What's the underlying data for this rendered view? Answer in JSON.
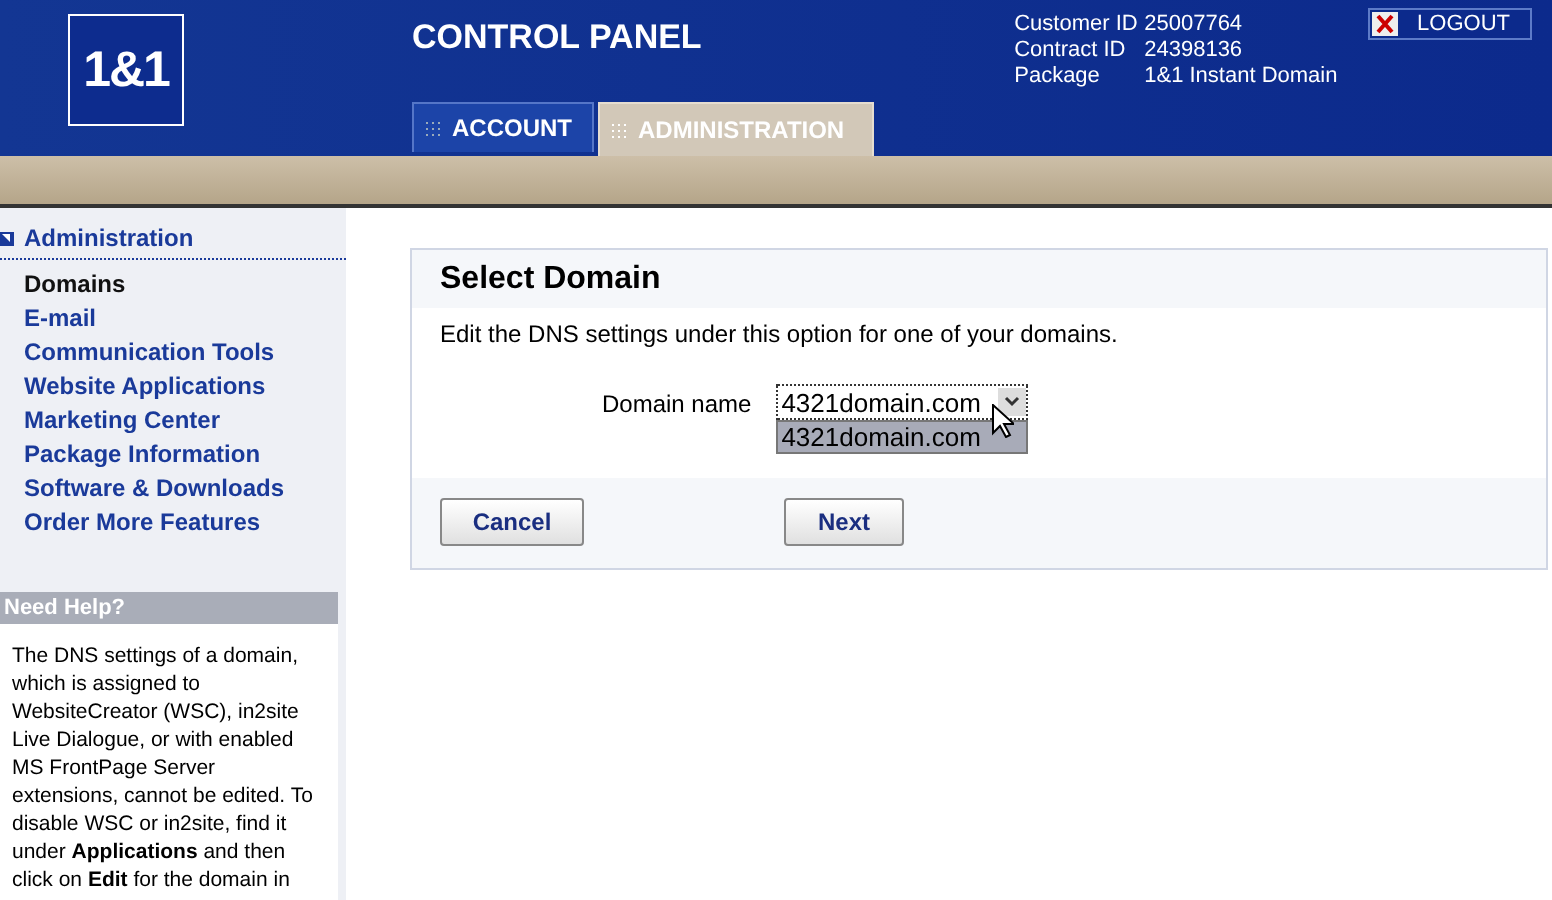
{
  "header": {
    "logo": "1&1",
    "title": "CONTROL PANEL",
    "account_info": [
      {
        "label": "Customer ID",
        "value": "25007764"
      },
      {
        "label": "Contract ID",
        "value": "24398136"
      },
      {
        "label": "Package",
        "value": "1&1 Instant Domain"
      }
    ],
    "logout": "LOGOUT"
  },
  "tabs": [
    {
      "label": "ACCOUNT",
      "selected": false
    },
    {
      "label": "ADMINISTRATION",
      "selected": true
    }
  ],
  "sidebar": {
    "heading": "Administration",
    "items": [
      {
        "label": "Domains",
        "selected": true
      },
      {
        "label": "E-mail",
        "selected": false
      },
      {
        "label": "Communication Tools",
        "selected": false
      },
      {
        "label": "Website Applications",
        "selected": false
      },
      {
        "label": "Marketing Center",
        "selected": false
      },
      {
        "label": "Package Information",
        "selected": false
      },
      {
        "label": "Software & Downloads",
        "selected": false
      },
      {
        "label": "Order More Features",
        "selected": false
      }
    ],
    "help_title": "Need Help?",
    "help_text": "The DNS settings of a domain, which is assigned to WebsiteCreator (WSC), in2site Live Dialogue, or with enabled MS FrontPage Server extensions, cannot be edited. To disable WSC or in2site, find it under **Applications** and then click on **Edit** for the domain in"
  },
  "panel": {
    "title": "Select Domain",
    "description": "Edit the DNS settings under this option for one of your domains.",
    "field_label": "Domain name",
    "select_value": "4321domain.com",
    "options": [
      {
        "label": "4321domain.com",
        "selected": true
      }
    ],
    "buttons": [
      "Cancel",
      "Next"
    ]
  }
}
